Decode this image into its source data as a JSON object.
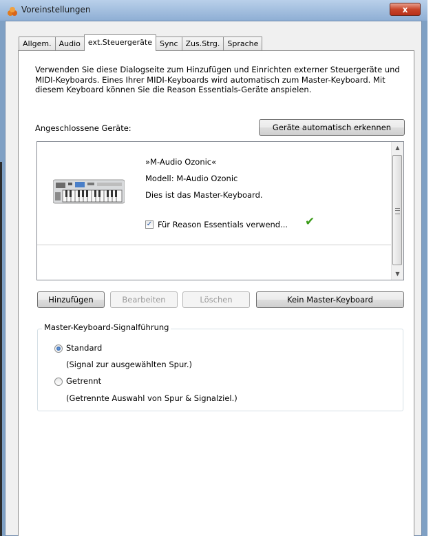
{
  "window": {
    "title": "Voreinstellungen",
    "close_label": "x"
  },
  "tabs": [
    {
      "label": "Allgem.",
      "active": false
    },
    {
      "label": "Audio",
      "active": false
    },
    {
      "label": "ext.Steuergeräte",
      "active": true
    },
    {
      "label": "Sync",
      "active": false
    },
    {
      "label": "Zus.Strg.",
      "active": false
    },
    {
      "label": "Sprache",
      "active": false
    }
  ],
  "description": "Verwenden Sie diese Dialogseite zum Hinzufügen und Einrichten externer Steuergeräte und MIDI-Keyboards. Eines Ihrer MIDI-Keyboards wird automatisch zum Master-Keyboard. Mit diesem Keyboard können Sie die Reason Essentials-Geräte anspielen.",
  "connected_label": "Angeschlossene Geräte:",
  "autodetect_button": "Geräte automatisch erkennen",
  "device": {
    "name": "»M-Audio Ozonic«",
    "model": "Modell: M-Audio Ozonic",
    "status": "Dies ist das Master-Keyboard.",
    "use_checkbox_label": "Für Reason Essentials verwend...",
    "use_checked": true,
    "icon": "midi-keyboard-image",
    "status_icon": "green-checkmark-icon"
  },
  "buttons": {
    "add": "Hinzufügen",
    "edit": "Bearbeiten",
    "delete": "Löschen",
    "no_master": "Kein Master-Keyboard"
  },
  "routing": {
    "title": "Master-Keyboard-Signalführung",
    "options": [
      {
        "label": "Standard",
        "description": "(Signal zur ausgewählten Spur.)",
        "selected": true
      },
      {
        "label": "Getrennt",
        "description": "(Getrennte Auswahl von Spur & Signalziel.)",
        "selected": false
      }
    ]
  },
  "colors": {
    "title_bar": "#a9c3e2",
    "close_button": "#c8452a",
    "check_green": "#3a9b18"
  }
}
